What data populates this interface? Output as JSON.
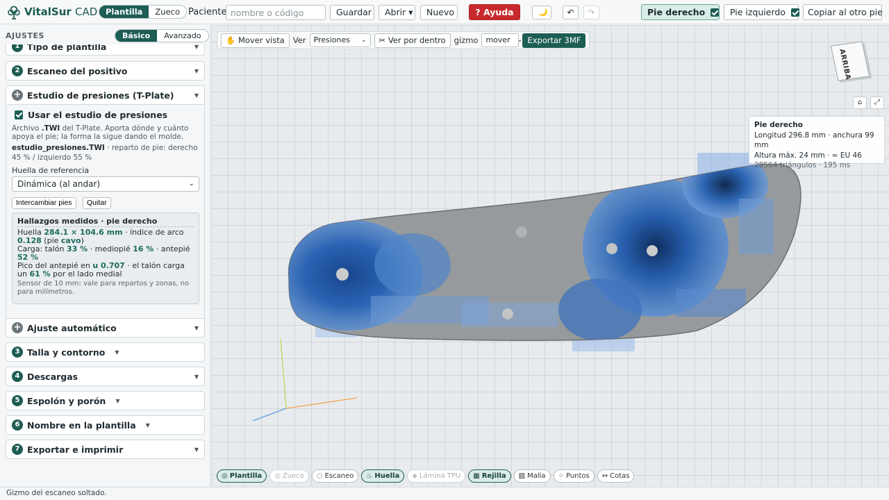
{
  "app": {
    "name": "VitalSur",
    "name_suffix": "CAD"
  },
  "header": {
    "mode_tabs": [
      {
        "label": "Plantilla",
        "active": true
      },
      {
        "label": "Zueco",
        "active": false
      }
    ],
    "patient_label": "Paciente",
    "patient_input": {
      "value": "",
      "placeholder": "nombre o código"
    },
    "save_label": "Guardar",
    "open_label": "Abrir ▾",
    "new_label": "Nuevo",
    "help_label": "? Ayuda",
    "theme_icon": "moon-icon",
    "undo_icon": "undo-icon",
    "redo_icon": "redo-icon",
    "right_foot": {
      "label": "Pie derecho",
      "checked": true
    },
    "left_foot": {
      "label": "Pie izquierdo",
      "checked": true
    },
    "copy_label": "Copiar al otro pie"
  },
  "sidebar": {
    "title": "AJUSTES",
    "level_tabs": [
      {
        "label": "Básico",
        "active": true
      },
      {
        "label": "Avanzado",
        "active": false
      }
    ],
    "sections": [
      {
        "number": "1",
        "title": "Tipo de plantilla"
      },
      {
        "number": "2",
        "title": "Escaneo del positivo"
      },
      {
        "number": "+",
        "title": "Estudio de presiones (T-Plate)",
        "expanded": true
      },
      {
        "number": "+",
        "title": "Ajuste automático"
      },
      {
        "number": "3",
        "title": "Talla y contorno"
      },
      {
        "number": "4",
        "title": "Descargas"
      },
      {
        "number": "5",
        "title": "Espolón y porón"
      },
      {
        "number": "6",
        "title": "Nombre en la plantilla"
      },
      {
        "number": "7",
        "title": "Exportar e imprimir"
      }
    ],
    "pressure": {
      "use_label": "Usar el estudio de presiones",
      "use_checked": true,
      "desc_prefix": "Archivo",
      "desc_ext": ".TWI",
      "desc_rest": "del T-Plate. Aporta dónde y cuánto apoya el pie; la forma la sigue dando el molde.",
      "file_name": "estudio_presiones.TWI",
      "file_split": "· reparto de pie: derecho 45 % / izquierdo 55 %",
      "ref_label": "Huella de referencia",
      "ref_value": "Dinámica (al andar)",
      "swap_label": "Intercambiar pies",
      "remove_label": "Quitar",
      "findings": {
        "title": "Hallazgos medidos · pie derecho",
        "footprint_label": "Huella",
        "footprint_value": "284.1 × 104.6 mm",
        "arch_label": "· índice de arco",
        "arch_value": "0.128",
        "foot_type_prefix": "(pie",
        "foot_type": "cavo",
        "foot_type_suffix": ")",
        "load_label": "Carga: talón",
        "heel": "33 %",
        "mid_label": "· mediopié",
        "mid": "16 %",
        "fore_label": "· antepié",
        "fore": "52 %",
        "peak_label": "Pico del antepié en",
        "peak": "u 0.707",
        "heel_load_label": "· el talón carga un",
        "medial": "61 %",
        "medial_suffix": "por el lado medial",
        "note": "Sensor de 10 mm: vale para repartos y zonas, no para milímetros."
      }
    }
  },
  "viewport": {
    "toolbar": {
      "move_label": "✋ Mover vista",
      "view_label": "Ver",
      "view_value": "Presiones",
      "inside_label": "✂ Ver por dentro",
      "gizmo_label": "gizmo",
      "gizmo_value": "mover",
      "export_label": "Exportar 3MF"
    },
    "cube_label": "ARRIBA",
    "home_icon": "⌂",
    "expand_icon": "⤢",
    "info": {
      "title": "Pie derecho",
      "line1": "Longitud 296.8 mm · anchura 99 mm",
      "line2": "Altura máx. 24 mm · ≈ EU 46",
      "line3": "28564 triángulos · 195 ms"
    },
    "chips": [
      {
        "label": "Plantilla",
        "state": "active"
      },
      {
        "label": "Zueco",
        "state": "disabled"
      },
      {
        "label": "Escaneo",
        "state": "normal"
      },
      {
        "label": "Huella",
        "state": "active"
      },
      {
        "label": "Lámina TPU",
        "state": "disabled"
      },
      {
        "label": "Rejilla",
        "state": "active"
      },
      {
        "label": "Malla",
        "state": "normal"
      },
      {
        "label": "Puntos",
        "state": "normal"
      },
      {
        "label": "Cotas",
        "state": "normal"
      }
    ]
  },
  "status": {
    "text": "Gizmo del escaneo soltado."
  },
  "colors": {
    "accent": "#1d5d53",
    "help": "#c8292c",
    "pressure": "#1f64b3"
  }
}
